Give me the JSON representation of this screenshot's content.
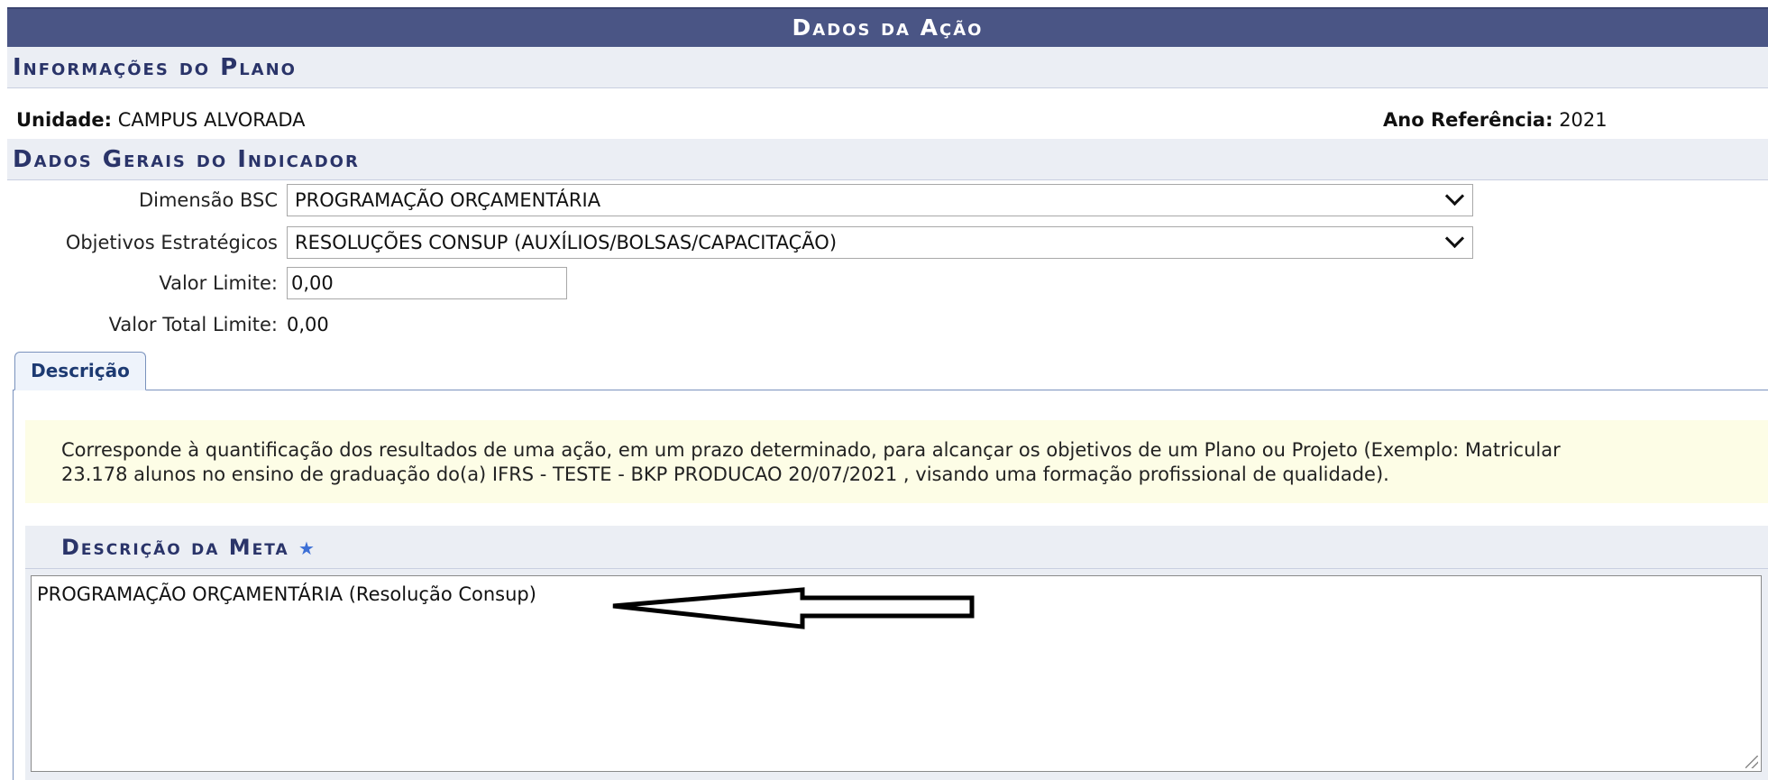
{
  "header": {
    "title": "Dados da Ação"
  },
  "plano": {
    "section_title": "Informações do Plano",
    "unidade_label": "Unidade:",
    "unidade_value": "CAMPUS ALVORADA",
    "ano_label": "Ano Referência:",
    "ano_value": "2021"
  },
  "indicador": {
    "section_title": "Dados Gerais do Indicador",
    "dimensao_label": "Dimensão BSC",
    "dimensao_value": "PROGRAMAÇÃO ORÇAMENTÁRIA",
    "objetivos_label": "Objetivos Estratégicos",
    "objetivos_value": "RESOLUÇÕES CONSUP (AUXÍLIOS/BOLSAS/CAPACITAÇÃO)",
    "valor_limite_label": "Valor Limite:",
    "valor_limite_value": "0,00",
    "valor_total_label": "Valor Total Limite:",
    "valor_total_value": "0,00"
  },
  "tabs": [
    {
      "label": "Descrição"
    }
  ],
  "hint": {
    "line1": "Corresponde à quantificação dos resultados de uma ação, em um prazo determinado, para alcançar os objetivos de um Plano ou Projeto (Exemplo: Matricular",
    "line2": "23.178 alunos no ensino de graduação do(a) IFRS - TESTE - BKP PRODUCAO 20/07/2021 , visando uma formação profissional de qualidade)."
  },
  "meta": {
    "title": "Descrição da Meta",
    "required_mark": "★",
    "value": "PROGRAMAÇÃO ORÇAMENTÁRIA (Resolução Consup)"
  },
  "icons": {
    "dropdown": "chevron-down-icon",
    "annotation": "arrow-left-icon",
    "required": "star-icon"
  }
}
